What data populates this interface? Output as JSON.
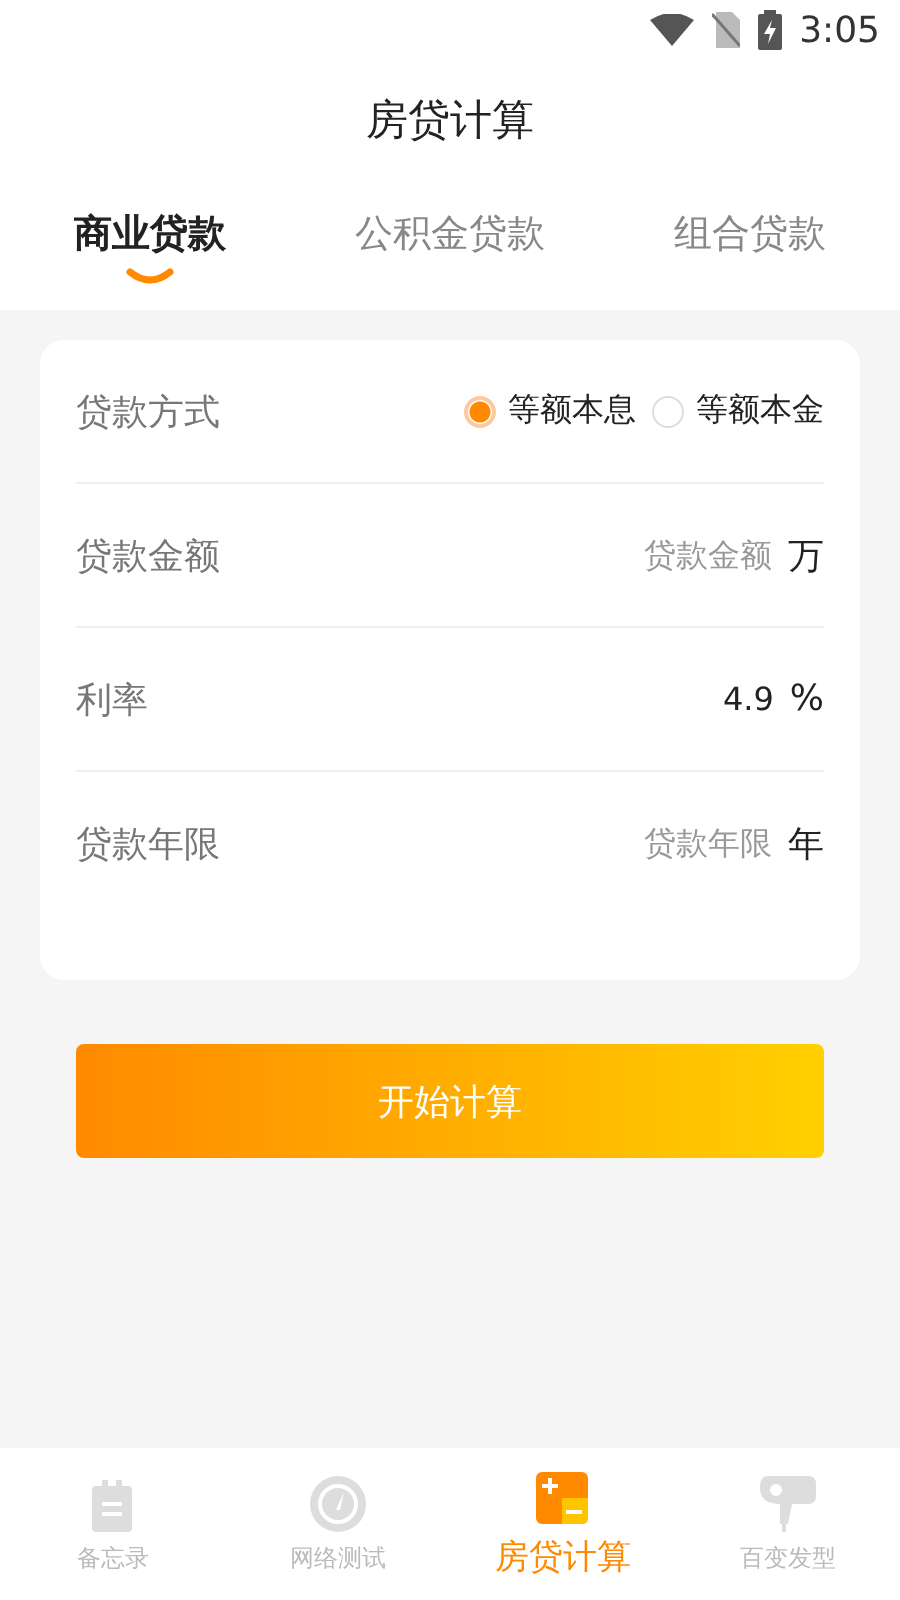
{
  "status_bar": {
    "time": "3:05"
  },
  "title": "房贷计算",
  "tabs": [
    {
      "label": "商业贷款",
      "selected": true
    },
    {
      "label": "公积金贷款",
      "selected": false
    },
    {
      "label": "组合贷款",
      "selected": false
    }
  ],
  "form": [
    {
      "kind": "radio",
      "label": "贷款方式",
      "options": [
        {
          "label": "等额本息",
          "selected": true
        },
        {
          "label": "等额本金",
          "selected": false
        }
      ]
    },
    {
      "kind": "input",
      "label": "贷款金额",
      "placeholder": "贷款金额",
      "unit": "万"
    },
    {
      "kind": "input",
      "label": "利率",
      "value": "4.9",
      "unit": "%"
    },
    {
      "kind": "input",
      "label": "贷款年限",
      "placeholder": "贷款年限",
      "unit": "年"
    }
  ],
  "submit": "开始计算",
  "nav": [
    {
      "kind": "notes",
      "label": "备忘录",
      "selected": false
    },
    {
      "kind": "gauge",
      "label": "网络测试",
      "selected": false
    },
    {
      "kind": "calc",
      "label": "房贷计算",
      "selected": true
    },
    {
      "kind": "dryer",
      "label": "百变发型",
      "selected": false
    }
  ]
}
